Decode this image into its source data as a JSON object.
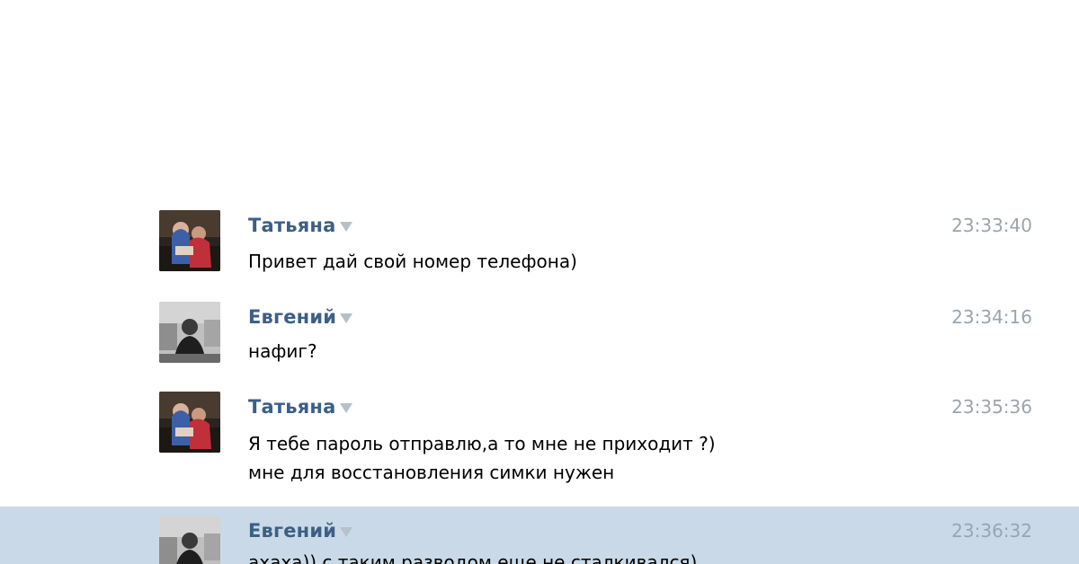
{
  "messages": [
    {
      "author": "Татьяна",
      "time": "23:33:40",
      "lines": [
        "Привет дай свой номер телефона)"
      ],
      "avatar": "tatyana-avatar",
      "highlighted": false
    },
    {
      "author": "Евгений",
      "time": "23:34:16",
      "lines": [
        "нафиг?"
      ],
      "avatar": "evgeny-avatar",
      "highlighted": false
    },
    {
      "author": "Татьяна",
      "time": "23:35:36",
      "lines": [
        "Я тебе пароль отправлю,а то мне не приходит ?)",
        "мне для восстановления симки нужен"
      ],
      "avatar": "tatyana-avatar",
      "highlighted": false
    },
    {
      "author": "Евгений",
      "time": "23:36:32",
      "lines": [
        "ахаха)) с таким разводом еще не сталкивался)"
      ],
      "avatar": "evgeny-avatar",
      "highlighted": true
    }
  ],
  "colors": {
    "author": "#3c5f85",
    "time": "#9ba4ad",
    "highlight": "#c9d9e7",
    "chevron": "#b7c0ca"
  }
}
